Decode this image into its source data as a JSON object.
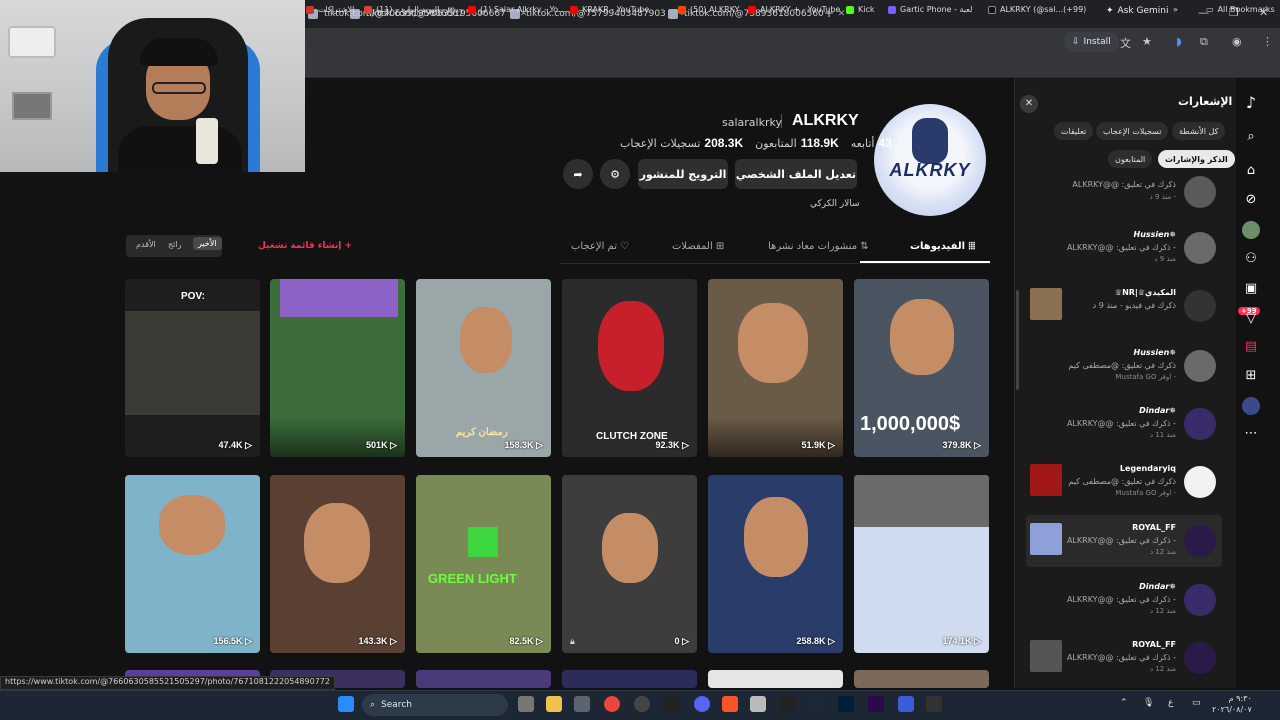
{
  "browser": {
    "tabs": [
      {
        "title": "tiktok.com/@70635195606667"
      },
      {
        "title": "tiktok.com/@75799403487903"
      },
      {
        "title": "tiktok.com/@75893618006560"
      }
    ],
    "ask_gemini": "Ask Gemini",
    "install": "Install",
    "bookmarks": [
      {
        "label": "الاشتراكات",
        "color": "#cc3333"
      },
      {
        "label": "البريد الوارد - (11) - m...",
        "color": "#d44638"
      },
      {
        "label": "(1) Salar Alkrky - Yo...",
        "color": "#ff0000"
      },
      {
        "label": "KRAKR - YouTube",
        "color": "#ff0000"
      },
      {
        "label": "(50) ALKRKY",
        "color": "#ff4500"
      },
      {
        "label": "ALKRKY + - YouTube",
        "color": "#ff0000"
      },
      {
        "label": "Kick",
        "color": "#53fc18"
      },
      {
        "label": "Gartic Phone - لعبة",
        "color": "#7b5cff"
      },
      {
        "label": "ALKRKY (@sal...(+99)",
        "color": "#111111"
      }
    ],
    "all_bookmarks": "All Bookmarks",
    "status_url": "https://www.tiktok.com/@7660630585521505297/photo/7671081222054890772"
  },
  "profile": {
    "name": "ALKRKY",
    "handle": "salaralkrky",
    "stats": [
      {
        "value": "43",
        "label": "أتابعه"
      },
      {
        "value": "118.9K",
        "label": "المتابعون"
      },
      {
        "value": "208.3K",
        "label": "تسجيلات الإعجاب"
      }
    ],
    "edit_profile": "تعديل الملف الشخصي",
    "promote_post": "الترويج للمنشور",
    "bio": "سالار الكركي",
    "avatar_text": "ALKRKY"
  },
  "content_tabs": {
    "videos": "الفيديوهات",
    "reposts": "منشورات معاد نشرها",
    "favorites": "المفضلات",
    "liked": "تم الإعجاب"
  },
  "sort": {
    "latest": "الأخير",
    "popular": "رائج",
    "oldest": "الأقدم"
  },
  "create_playlist": "إنشاء قائمة تشغيل",
  "videos": [
    {
      "views": "379.8K",
      "caption": "1,000,000$",
      "bg": "#4a5561"
    },
    {
      "views": "51.9K",
      "caption": "",
      "bg": "#6a5a48"
    },
    {
      "views": "92.3K",
      "caption": "CLUTCH ZONE",
      "bg": "#2b2b2b"
    },
    {
      "views": "158.3K",
      "caption": "رمضان كريم",
      "bg": "#9aa6a8"
    },
    {
      "views": "501K",
      "caption": "",
      "bg": "#3c6d3b"
    },
    {
      "views": "47.4K",
      "caption": "POV:",
      "bg": "#1e1e1e"
    },
    {
      "views": "174.1K",
      "caption": "",
      "bg": "#cfdcf0"
    },
    {
      "views": "258.8K",
      "caption": "",
      "bg": "#2a3d6a"
    },
    {
      "views": "0",
      "caption": "",
      "bg": "#3d3d3d"
    },
    {
      "views": "82.5K",
      "caption": "GREEN LIGHT",
      "bg": "#7a8a55"
    },
    {
      "views": "143.3K",
      "caption": "",
      "bg": "#5a4032"
    },
    {
      "views": "156.5K",
      "caption": "",
      "bg": "#7eb3c9"
    }
  ],
  "notifications": {
    "title": "الإشعارات",
    "filters": [
      "كل الأنشطة",
      "تسجيلات الإعجاب",
      "تعليقات",
      "الذكر والإشارات",
      "المتابعون"
    ],
    "items": [
      {
        "name": "",
        "line": "ALKRKY@@ :ذكرك في تعليق",
        "time": "منذ 9 د -"
      },
      {
        "name": "Hussien✵",
        "line": "ALKRKY@@ :ذكرك في تعليق -",
        "time": "منذ 9 د"
      },
      {
        "name": "♕NR|♕المكيدي",
        "line": "ذكرك في فيديو - منذ 9 د",
        "time": ""
      },
      {
        "name": "Hussien✵",
        "line": "ذكرك في تعليق: @مصطفى كيم",
        "time": "Mustafa GO اوفر -"
      },
      {
        "name": "Dindar✵",
        "line": "ALKRKY@@ :ذكرك في تعليق -",
        "time": "منذ 11 د"
      },
      {
        "name": "Legendaryiq",
        "line": "ذكرك في تعليق: @مصطفى كيم",
        "time": "Mustafa GO اوفر -"
      },
      {
        "name": "ROYAL_FF",
        "line": "ALKRKY@@ :ذكرك في تعليق -",
        "time": "منذ 12 د"
      },
      {
        "name": "Dindar✵",
        "line": "ALKRKY@@ :ذكرك في تعليق -",
        "time": "منذ 12 د"
      },
      {
        "name": "ROYAL_FF",
        "line": "ALKRKY@@ :ذكرك في تعليق -",
        "time": "منذ 12 د"
      }
    ]
  },
  "rail": {
    "badge": "+99"
  },
  "taskbar": {
    "search": "Search",
    "lang": "ع",
    "time": "٩:٣٠ م",
    "date": "٢٠٢٦/٠٨/٠٧"
  }
}
